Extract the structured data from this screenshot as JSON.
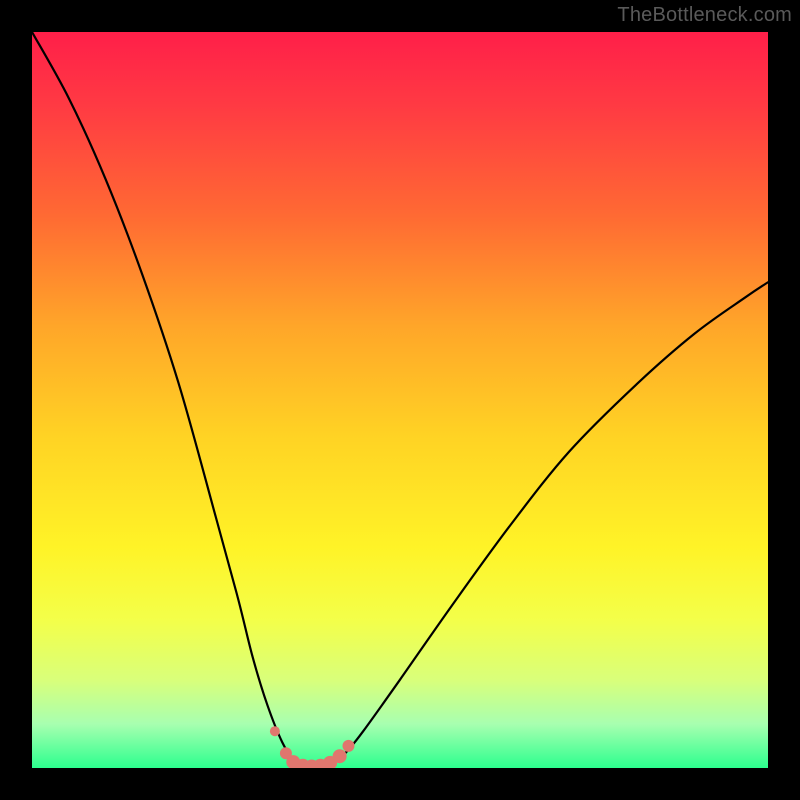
{
  "watermark": {
    "text": "TheBottleneck.com"
  },
  "colors": {
    "frame": "#000000",
    "curve_stroke": "#000000",
    "dots_fill": "#e0766e",
    "gradient_stops": [
      {
        "offset": 0.0,
        "color": "#ff1f49"
      },
      {
        "offset": 0.1,
        "color": "#ff3a43"
      },
      {
        "offset": 0.25,
        "color": "#ff6a33"
      },
      {
        "offset": 0.4,
        "color": "#ffa629"
      },
      {
        "offset": 0.55,
        "color": "#ffd324"
      },
      {
        "offset": 0.7,
        "color": "#fff327"
      },
      {
        "offset": 0.8,
        "color": "#f3ff4a"
      },
      {
        "offset": 0.88,
        "color": "#d9ff7a"
      },
      {
        "offset": 0.94,
        "color": "#a8ffb0"
      },
      {
        "offset": 1.0,
        "color": "#2cff8e"
      }
    ]
  },
  "chart_data": {
    "type": "line",
    "title": "",
    "xlabel": "",
    "ylabel": "",
    "xlim": [
      0,
      1
    ],
    "ylim": [
      0,
      100
    ],
    "note": "Axes are unlabeled; values are read from curve geometry as percentage of plot height (100 = top, 0 = bottom). Curve is an asymmetric V dipping to ~0 near x≈0.38.",
    "series": [
      {
        "name": "bottleneck-curve",
        "x": [
          0.0,
          0.05,
          0.1,
          0.15,
          0.2,
          0.25,
          0.28,
          0.3,
          0.32,
          0.34,
          0.355,
          0.37,
          0.385,
          0.4,
          0.415,
          0.43,
          0.45,
          0.5,
          0.57,
          0.65,
          0.73,
          0.82,
          0.9,
          0.97,
          1.0
        ],
        "y": [
          100.0,
          91.0,
          80.0,
          67.0,
          52.0,
          34.0,
          23.0,
          15.0,
          8.5,
          3.5,
          1.2,
          0.3,
          0.2,
          0.3,
          1.0,
          2.5,
          5.0,
          12.0,
          22.0,
          33.0,
          43.0,
          52.0,
          59.0,
          64.0,
          66.0
        ]
      }
    ],
    "markers": {
      "name": "trough-dots",
      "color": "#e0766e",
      "x": [
        0.33,
        0.345,
        0.355,
        0.368,
        0.38,
        0.392,
        0.405,
        0.418,
        0.43
      ],
      "y": [
        5.0,
        2.0,
        0.8,
        0.3,
        0.2,
        0.3,
        0.7,
        1.6,
        3.0
      ],
      "r": [
        5,
        6,
        7,
        7,
        7,
        7,
        7,
        7,
        6
      ]
    }
  }
}
